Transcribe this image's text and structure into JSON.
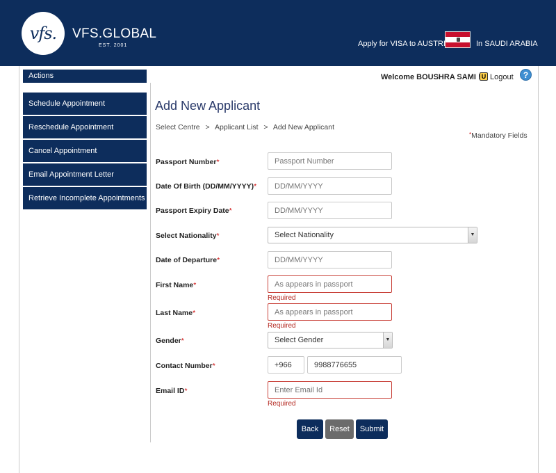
{
  "header": {
    "logo_mark": "vfs.",
    "brand": "VFS.GLOBAL",
    "est": "EST. 2001",
    "apply_text": "Apply for VISA to AUSTRIA",
    "in_text": "In SAUDI ARABIA",
    "flag_colors": [
      "#c8102e",
      "#ffffff",
      "#c8102e"
    ]
  },
  "sidebar": {
    "title": "Actions",
    "items": [
      {
        "label": "Schedule Appointment"
      },
      {
        "label": "Reschedule Appointment"
      },
      {
        "label": "Cancel Appointment"
      },
      {
        "label": "Email Appointment Letter"
      },
      {
        "label": "Retrieve Incomplete Appointments"
      }
    ]
  },
  "topbar": {
    "welcome": "Welcome BOUSHRA SAMI !",
    "logout_icon_glyph": "U",
    "logout": "Logout",
    "help_glyph": "?"
  },
  "page": {
    "title": "Add New Applicant",
    "breadcrumb": [
      "Select Centre",
      "Applicant List",
      "Add New Applicant"
    ],
    "breadcrumb_sep": ">",
    "mandatory_ast": "*",
    "mandatory": "Mandatory Fields"
  },
  "form": {
    "required_marker": "*",
    "passport_number": {
      "label": "Passport Number",
      "placeholder": "Passport Number"
    },
    "dob": {
      "label": "Date Of Birth (DD/MM/YYYY)",
      "placeholder": "DD/MM/YYYY"
    },
    "passport_expiry": {
      "label": "Passport Expiry Date",
      "placeholder": "DD/MM/YYYY"
    },
    "nationality": {
      "label": "Select Nationality",
      "value": "Select Nationality"
    },
    "departure": {
      "label": "Date of Departure",
      "placeholder": "DD/MM/YYYY"
    },
    "first_name": {
      "label": "First Name",
      "placeholder": "As appears in passport",
      "error": "Required"
    },
    "last_name": {
      "label": "Last Name",
      "placeholder": "As appears in passport",
      "error": "Required"
    },
    "gender": {
      "label": "Gender",
      "value": "Select Gender"
    },
    "contact": {
      "label": "Contact Number",
      "code": "+966",
      "number": "9988776655"
    },
    "email": {
      "label": "Email ID",
      "placeholder": "Enter Email Id",
      "error": "Required"
    }
  },
  "buttons": {
    "back": "Back",
    "reset": "Reset",
    "submit": "Submit"
  },
  "colors": {
    "primary": "#0d2d5c",
    "error": "#c9423a",
    "reset_button": "#6b6b6b"
  }
}
